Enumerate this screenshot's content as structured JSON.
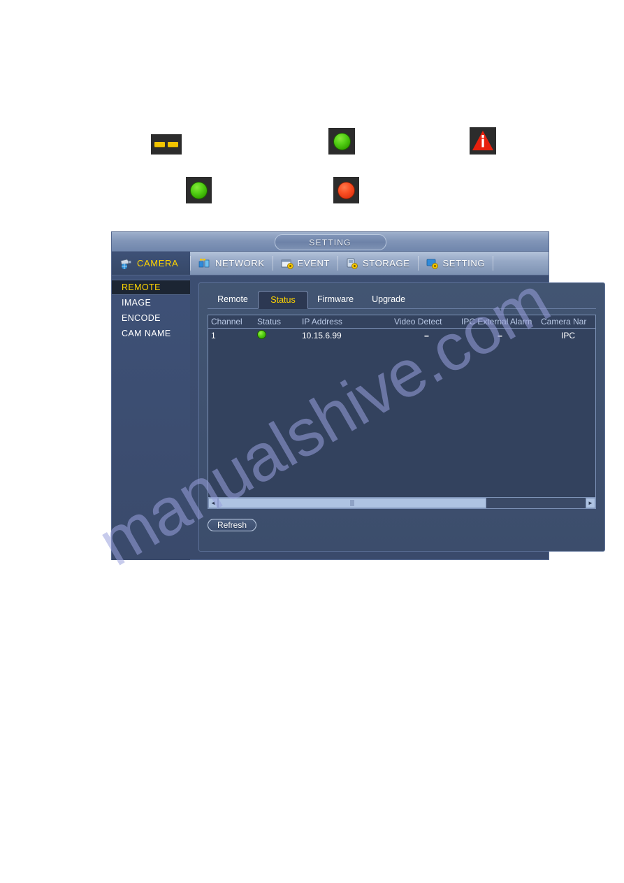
{
  "legend_icons": [
    {
      "name": "dashes-icon",
      "glyph": "--",
      "label": "--"
    },
    {
      "name": "green-led-icon",
      "glyph": "circle",
      "label": "green"
    },
    {
      "name": "warning-triangle-icon",
      "glyph": "triangle",
      "label": "alarm"
    },
    {
      "name": "green-led-icon-2",
      "glyph": "circle",
      "label": "green"
    },
    {
      "name": "red-led-icon",
      "glyph": "circle",
      "label": "red"
    }
  ],
  "window": {
    "title": "SETTING",
    "menu": [
      {
        "label": "CAMERA",
        "icon": "camera-icon",
        "active": true
      },
      {
        "label": "NETWORK",
        "icon": "network-icon",
        "active": false
      },
      {
        "label": "EVENT",
        "icon": "event-icon",
        "active": false
      },
      {
        "label": "STORAGE",
        "icon": "storage-icon",
        "active": false
      },
      {
        "label": "SETTING",
        "icon": "setting-icon",
        "active": false
      }
    ],
    "sidebar": [
      {
        "label": "REMOTE",
        "active": true
      },
      {
        "label": "IMAGE",
        "active": false
      },
      {
        "label": "ENCODE",
        "active": false
      },
      {
        "label": "CAM NAME",
        "active": false
      }
    ],
    "sub_tabs": [
      {
        "label": "Remote",
        "active": false
      },
      {
        "label": "Status",
        "active": true
      },
      {
        "label": "Firmware",
        "active": false
      },
      {
        "label": "Upgrade",
        "active": false
      }
    ],
    "table": {
      "headers": [
        "Channel",
        "Status",
        "IP Address",
        "Video Detect",
        "IPC External Alarm",
        "Camera Nar"
      ],
      "rows": [
        {
          "channel": "1",
          "status": "green-dot",
          "ip_address": "10.15.6.99",
          "video_detect": "--",
          "ipc_external_alarm": "--",
          "camera_name": "IPC"
        }
      ]
    },
    "scrollbar": {
      "left_arrow": "◄",
      "right_arrow": "►",
      "thumb_percent": 73
    },
    "refresh_label": "Refresh"
  },
  "watermark": {
    "text": "manualshive.com",
    "color": "#9aa2de"
  }
}
